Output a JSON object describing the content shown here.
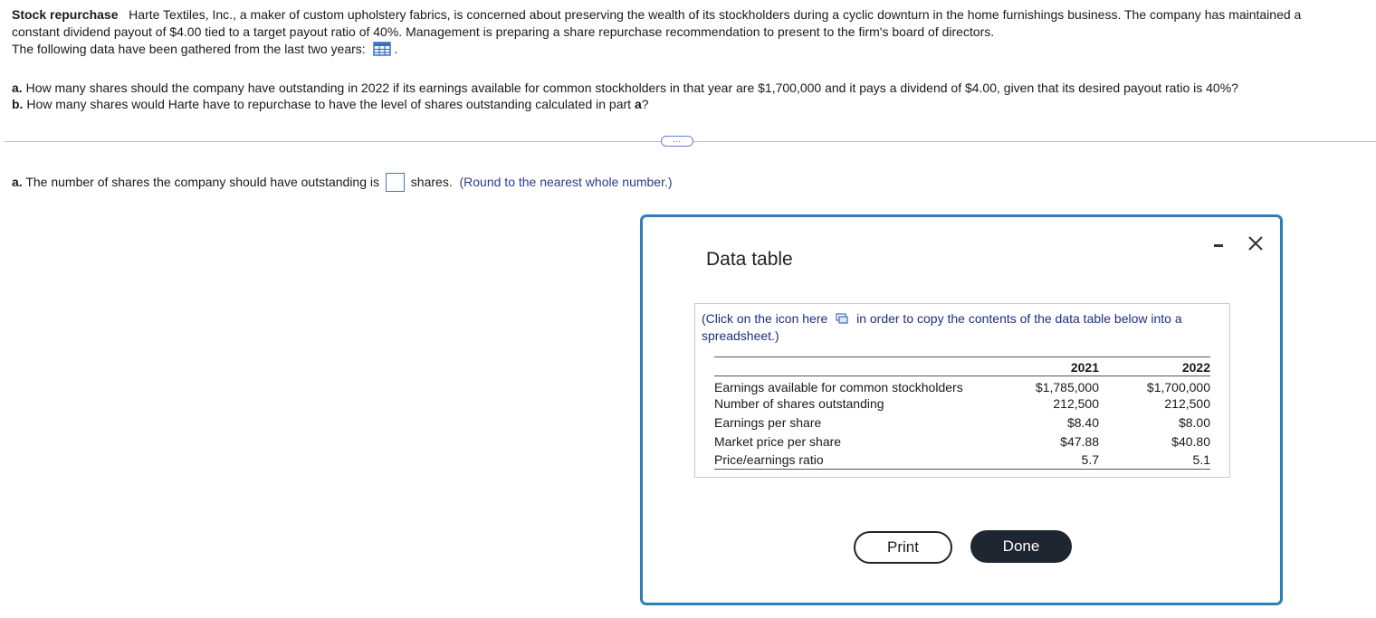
{
  "problem": {
    "heading": "Stock repurchase",
    "text_line1": "Harte Textiles, Inc., a maker of custom upholstery fabrics, is concerned about preserving the wealth of its stockholders during a cyclic downturn in the home furnishings business.  The company has maintained a",
    "text_line2": "constant dividend payout of $4.00 tied to a target payout ratio of 40%.  Management is preparing a share repurchase recommendation to present to the firm's board of directors.",
    "data_line": "The following data have been gathered from the last two years:",
    "data_line_end": "."
  },
  "parts": {
    "a_label": "a.",
    "a_text": "How many shares should the company have outstanding in 2022 if its earnings available for common stockholders in that year are $1,700,000 and it pays a dividend of $4.00, given that its desired payout ratio is 40%?",
    "b_label": "b.",
    "b_text": "How many shares would Harte have to repurchase to have the level of shares outstanding calculated in part",
    "b_ref": "a",
    "b_end": "?"
  },
  "more_button": "…",
  "answer": {
    "label": "a.",
    "text_before": "The number of shares the company should have outstanding is",
    "input_value": "",
    "text_after": "shares.",
    "hint": "(Round to the nearest whole number.)"
  },
  "modal": {
    "title": "Data table",
    "minimize_icon": "minimize-icon",
    "close_icon": "close-icon",
    "note_before": "(Click on the icon here",
    "note_after": "in order to copy the contents of the data table below into a spreadsheet.)",
    "table": {
      "headers": [
        "",
        "2021",
        "2022"
      ],
      "rows": [
        [
          "Earnings available for common stockholders",
          "$1,785,000",
          "$1,700,000"
        ],
        [
          "Number of shares outstanding",
          "212,500",
          "212,500"
        ],
        [
          "Earnings per share",
          "$8.40",
          "$8.00"
        ],
        [
          "Market price per share",
          "$47.88",
          "$40.80"
        ],
        [
          "Price/earnings ratio",
          "5.7",
          "5.1"
        ]
      ]
    },
    "print_label": "Print",
    "done_label": "Done"
  },
  "colors": {
    "modal_border": "#2e7db5",
    "hint_text": "#2d3b8c",
    "done_bg": "#1e2632"
  }
}
